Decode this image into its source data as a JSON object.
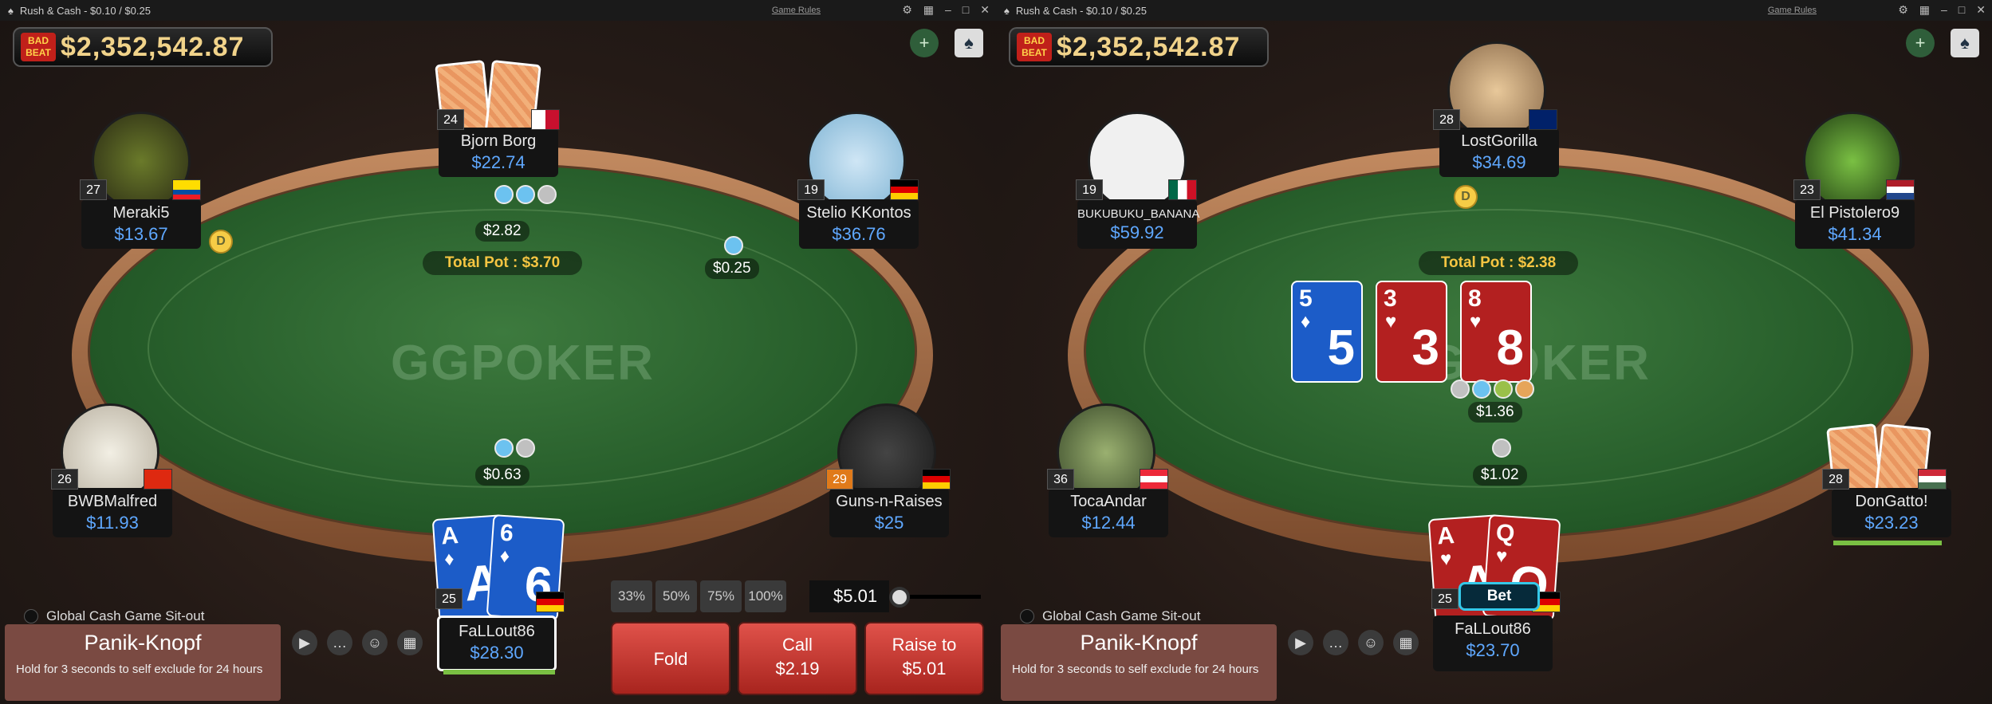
{
  "window_title": "Rush & Cash - $0.10 / $0.25",
  "game_rules": "Game Rules",
  "jackpot_logo": "BAD BEAT",
  "jackpot": "$2,352,542.87",
  "watermark": "GGPOKER",
  "sitout": "Global Cash Game Sit-out",
  "panik": {
    "title": "Panik-Knopf",
    "desc": "Hold for 3 seconds to self exclude for 24 hours"
  },
  "tables": [
    {
      "pot": "Total Pot : $3.70",
      "seats": [
        {
          "name": "Bjorn Borg",
          "stack": "$22.74",
          "level": "24",
          "flag": "malta"
        },
        {
          "name": "Meraki5",
          "stack": "$13.67",
          "level": "27",
          "flag": "ecuador"
        },
        {
          "name": "Stelio KKontos",
          "stack": "$36.76",
          "level": "19",
          "flag": "germany"
        },
        {
          "name": "BWBMalfred",
          "stack": "$11.93",
          "level": "26",
          "flag": "hong-kong"
        },
        {
          "name": "Guns-n-Raises",
          "stack": "$25",
          "level": "29",
          "flag": "germany"
        },
        {
          "name": "FaLLout86",
          "stack": "$28.30",
          "level": "25",
          "flag": "germany"
        }
      ],
      "bets": [
        "$2.82",
        "$0.25",
        "$0.63"
      ],
      "hero_cards": [
        {
          "rank": "A",
          "suit": "♦"
        },
        {
          "rank": "6",
          "suit": "♦"
        }
      ],
      "presets": [
        "33%",
        "50%",
        "75%",
        "100%"
      ],
      "bet_amount": "$5.01",
      "actions": {
        "fold": "Fold",
        "call": "Call",
        "call_amt": "$2.19",
        "raise": "Raise to",
        "raise_amt": "$5.01"
      }
    },
    {
      "pot": "Total Pot : $2.38",
      "seats": [
        {
          "name": "LostGorilla",
          "stack": "$34.69",
          "level": "28",
          "flag": "uk"
        },
        {
          "name": "BUKUBUKU_BANANA",
          "stack": "$59.92",
          "level": "19",
          "flag": "mexico"
        },
        {
          "name": "El Pistolero9",
          "stack": "$41.34",
          "level": "23",
          "flag": "netherlands"
        },
        {
          "name": "TocaAndar",
          "stack": "$12.44",
          "level": "36",
          "flag": "austria"
        },
        {
          "name": "DonGatto!",
          "stack": "$23.23",
          "level": "28",
          "flag": "hungary"
        },
        {
          "name": "FaLLout86",
          "stack": "$23.70",
          "level": "25",
          "flag": "germany"
        }
      ],
      "bets": [
        "$1.36",
        "$1.02"
      ],
      "board": [
        {
          "rank": "5",
          "suit": "♦",
          "color": "blue"
        },
        {
          "rank": "3",
          "suit": "♥",
          "color": "red"
        },
        {
          "rank": "8",
          "suit": "♥",
          "color": "red"
        }
      ],
      "hero_cards": [
        {
          "rank": "A",
          "suit": "♥"
        },
        {
          "rank": "Q",
          "suit": "♥"
        }
      ],
      "hero_action": "Bet"
    }
  ],
  "colors": {
    "felt": "#2f6a32",
    "stack": "#5fa8ff",
    "pot_text": "#f5c542",
    "action_btn": "#c53a32",
    "bet_pill": "#35c8e8"
  }
}
